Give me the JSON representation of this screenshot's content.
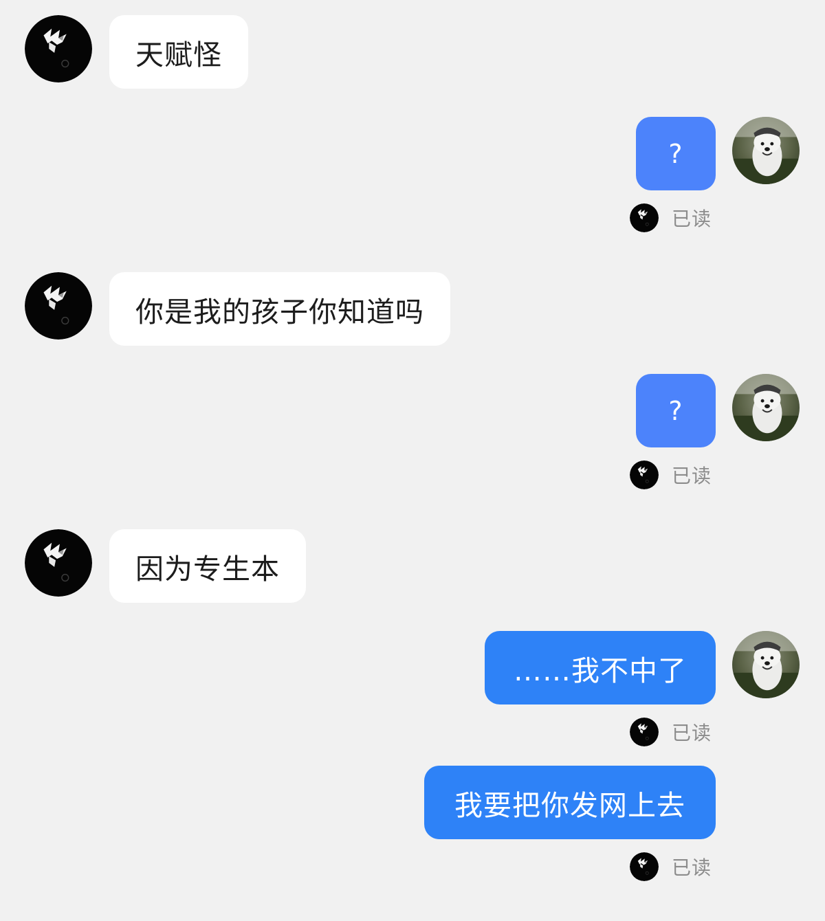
{
  "chat": {
    "theme": {
      "background": "#f1f1f1",
      "incoming_bubble": "#ffffff",
      "outgoing_bubble_soft": "#4c83fb",
      "outgoing_bubble_strong": "#2e82f7",
      "read_label_color": "#8c8c8c"
    },
    "read_label": "已读",
    "messages": [
      {
        "sender": "them",
        "text": "天赋怪",
        "avatar_icon": "anime-character-avatar-icon"
      },
      {
        "sender": "me",
        "text": "?",
        "avatar_icon": "dog-photo-avatar-icon",
        "status": "已读"
      },
      {
        "sender": "them",
        "text": "你是我的孩子你知道吗",
        "avatar_icon": "anime-character-avatar-icon"
      },
      {
        "sender": "me",
        "text": "?",
        "avatar_icon": "dog-photo-avatar-icon",
        "status": "已读"
      },
      {
        "sender": "them",
        "text": "因为专生本",
        "avatar_icon": "anime-character-avatar-icon"
      },
      {
        "sender": "me",
        "text": "……我不中了",
        "avatar_icon": "dog-photo-avatar-icon",
        "status": "已读"
      },
      {
        "sender": "me",
        "text": "我要把你发网上去",
        "status": "已读"
      }
    ]
  }
}
